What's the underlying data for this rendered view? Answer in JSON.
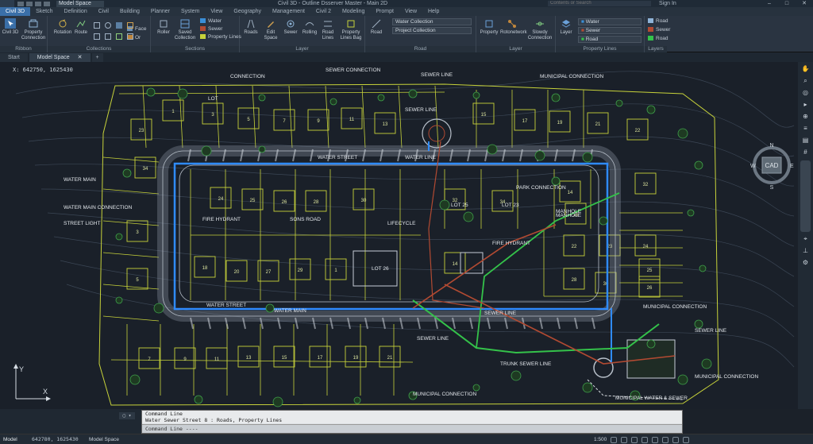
{
  "titlebar": {
    "app_title": "Civil 3D - Outline Dsserver Master - Main 2D",
    "workspace": "Model Space",
    "search_placeholder": "Contents or Search",
    "account": "Sign In"
  },
  "menu": {
    "tabs": [
      "Civil 3D",
      "Sketch",
      "Definition",
      "Civil",
      "Building",
      "Planner",
      "System",
      "View",
      "Geography",
      "Management",
      "Civil 2",
      "Modeling",
      "Prompt",
      "View",
      "Help"
    ],
    "active_index": 0
  },
  "ribbon": {
    "groups": [
      {
        "label": "Ribbon",
        "buttons": [
          "Civil 3D"
        ]
      },
      {
        "label": "Collections",
        "buttons": [
          "Property Connection",
          "Rotation",
          "Route"
        ],
        "small": [
          "Face",
          "Or",
          "Gr"
        ]
      },
      {
        "label": "Sections",
        "buttons": [
          "Roller",
          "Saved Collection",
          "Property Lines"
        ],
        "small": [
          "Water",
          "Sewer"
        ]
      },
      {
        "label": "Layer",
        "buttons": [
          "Roads",
          "Edit Space",
          "Sewer",
          "Rolling",
          "Road Lines",
          "Property Lines Bag"
        ]
      },
      {
        "label": "Road",
        "buttons": [
          "Road"
        ],
        "dropdowns": [
          "Water Collection",
          "Project Collection"
        ]
      },
      {
        "label": "Layer",
        "buttons": [
          "Property",
          "Rotonetwork",
          "Slowdy Connection"
        ]
      },
      {
        "label": "Property Lines",
        "buttons": [
          "Layer"
        ],
        "dropdowns": [
          "Water",
          "Sewer",
          "Road"
        ]
      },
      {
        "label": "Layers",
        "small": [
          "Road",
          "Sewer",
          "Road"
        ]
      }
    ]
  },
  "doctabs": [
    "Start",
    "Model Space"
  ],
  "viewport": {
    "label": "X: 642750, 1625430",
    "viewcube": {
      "n": "N",
      "w": "W",
      "e": "E",
      "s": "S",
      "center": "CAD"
    },
    "ucs": {
      "x": "X",
      "y": "Y"
    }
  },
  "plan_labels": {
    "connection": "CONNECTION",
    "sewer_connection": "SEWER CONNECTION",
    "sewer_line_top": "SEWER LINE",
    "municipal_connection_top": "MUNICIPAL CONNECTION",
    "water_main": "WATER MAIN",
    "water_main_connection": "WATER MAIN CONNECTION",
    "street_light": "STREET LIGHT",
    "fire_hydrant_left": "FIRE HYDRANT",
    "street_top": "WATER STREET",
    "storage_top": "WATER LINE",
    "sewer_line_mid": "SEWER LINE",
    "manhole": "MANHOLE",
    "lot_23": "LOT 23",
    "lot_25a": "LOT 25",
    "lot_26": "LOT 26",
    "lot_label_2": "LOT",
    "fire_hydrant_mid": "FIRE HYDRANT",
    "lifecycle": "LIFECYCLE",
    "water_street": "WATER STREET",
    "water_main_bottom": "WATER MAIN",
    "sewer_line_bottom": "SEWER LINE",
    "sewer_line_lower": "SEWER LINE",
    "municipal_connection_right": "MUNICIPAL CONNECTION",
    "sewer_line_right": "SEWER LINE",
    "municipal_connection_br": "MUNICIPAL CONNECTION",
    "trunk_sewer_line": "TRUNK SEWER LINE",
    "municipal_connection_bottom": "MUNICIPAL CONNECTION",
    "municipal_water": "MUNICIPAL WATER & SEWER",
    "park_label": "PARK CONNECTION",
    "sons": "SONS ROAD",
    "new_manhole": "MANHOLE"
  },
  "lots": [
    {
      "n": "1"
    },
    {
      "n": "3"
    },
    {
      "n": "5"
    },
    {
      "n": "7"
    },
    {
      "n": "9"
    },
    {
      "n": "11"
    },
    {
      "n": "13"
    },
    {
      "n": "15"
    },
    {
      "n": "17"
    },
    {
      "n": "19"
    },
    {
      "n": "21"
    },
    {
      "n": "22"
    },
    {
      "n": "23"
    },
    {
      "n": "24"
    },
    {
      "n": "25"
    },
    {
      "n": "26"
    },
    {
      "n": "28"
    },
    {
      "n": "30"
    },
    {
      "n": "32"
    },
    {
      "n": "34"
    },
    {
      "n": "14"
    },
    {
      "n": "16"
    },
    {
      "n": "18"
    },
    {
      "n": "20"
    },
    {
      "n": "27"
    },
    {
      "n": "29"
    }
  ],
  "command": {
    "history": [
      "Command Line",
      "Water Sewer Street 8 : Roads, Property Lines"
    ],
    "prompt": "Command Line ----"
  },
  "status": {
    "coords": "642780, 1625430",
    "layouts": [
      "Model",
      "Model Space"
    ],
    "scale": "1:500",
    "items": [
      "Model",
      "Grid",
      "Snap",
      "Ortho",
      "Polar",
      "OSnap",
      "3D",
      "Lwt"
    ]
  },
  "colors": {
    "lot_lines": "#c7d23a",
    "water": "#2f8bff",
    "sewer": "#b24a32",
    "green": "#34c24a",
    "background": "#1a2029"
  }
}
